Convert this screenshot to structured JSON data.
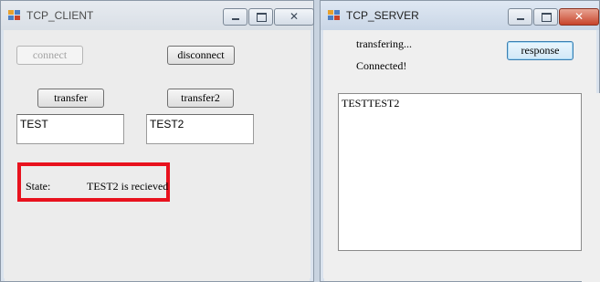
{
  "client": {
    "title": "TCP_CLIENT",
    "connect_label": "connect",
    "disconnect_label": "disconnect",
    "transfer_label": "transfer",
    "transfer2_label": "transfer2",
    "text1_value": "TEST",
    "text2_value": "TEST2",
    "state_label": "State:",
    "state_value": "TEST2 is recieved"
  },
  "server": {
    "title": "TCP_SERVER",
    "status_line1": "transfering...",
    "status_line2": "Connected!",
    "response_label": "response",
    "received_text": "TESTTEST2"
  },
  "colors": {
    "highlight": "#e8121e",
    "close_button": "#c8442b"
  }
}
